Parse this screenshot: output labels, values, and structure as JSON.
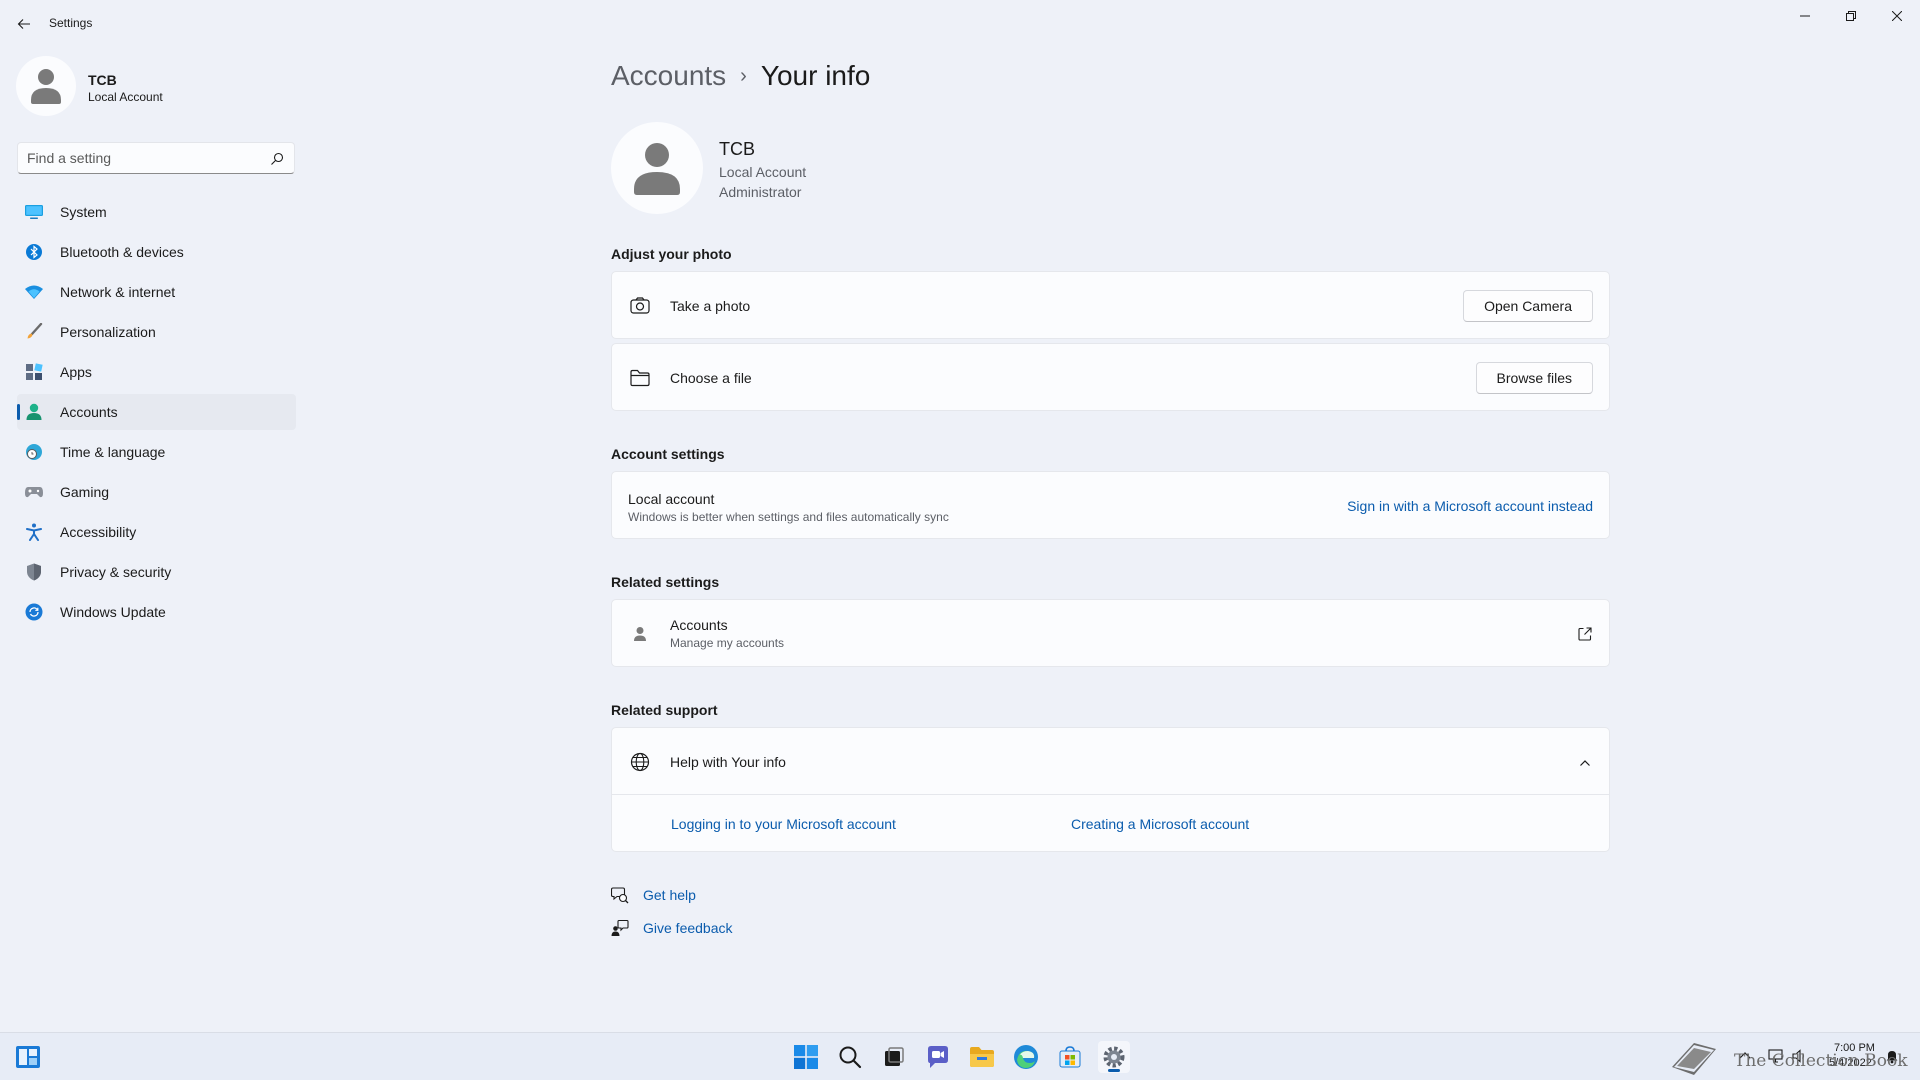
{
  "window": {
    "title": "Settings",
    "controls": [
      "minimize-icon",
      "restore-icon",
      "close-icon"
    ]
  },
  "profile": {
    "name": "TCB",
    "type": "Local Account"
  },
  "search": {
    "placeholder": "Find a setting"
  },
  "nav": {
    "items": [
      {
        "label": "System",
        "icon": "monitor-icon"
      },
      {
        "label": "Bluetooth & devices",
        "icon": "bluetooth-icon"
      },
      {
        "label": "Network & internet",
        "icon": "wifi-icon"
      },
      {
        "label": "Personalization",
        "icon": "brush-icon"
      },
      {
        "label": "Apps",
        "icon": "apps-icon"
      },
      {
        "label": "Accounts",
        "icon": "person-icon",
        "active": true
      },
      {
        "label": "Time & language",
        "icon": "globe-clock-icon"
      },
      {
        "label": "Gaming",
        "icon": "gamepad-icon"
      },
      {
        "label": "Accessibility",
        "icon": "accessibility-icon"
      },
      {
        "label": "Privacy & security",
        "icon": "shield-icon"
      },
      {
        "label": "Windows Update",
        "icon": "update-icon"
      }
    ]
  },
  "breadcrumb": {
    "parent": "Accounts",
    "separator": "›",
    "current": "Your info"
  },
  "user": {
    "name": "TCB",
    "account_type": "Local Account",
    "role": "Administrator"
  },
  "adjust_photo": {
    "title": "Adjust your photo",
    "take_photo": {
      "label": "Take a photo",
      "button": "Open Camera",
      "icon": "camera-icon"
    },
    "choose_file": {
      "label": "Choose a file",
      "button": "Browse files",
      "icon": "folder-icon"
    }
  },
  "account_settings": {
    "title": "Account settings",
    "local": {
      "label": "Local account",
      "description": "Windows is better when settings and files automatically sync",
      "link": "Sign in with a Microsoft account instead"
    }
  },
  "related_settings": {
    "title": "Related settings",
    "accounts": {
      "label": "Accounts",
      "description": "Manage my accounts",
      "icon": "person-icon",
      "action_icon": "external-link-icon"
    }
  },
  "related_support": {
    "title": "Related support",
    "help": {
      "label": "Help with Your info",
      "icon": "globe-icon",
      "expanded": true
    },
    "links": [
      "Logging in to your Microsoft account",
      "Creating a Microsoft account"
    ]
  },
  "footer": {
    "get_help": "Get help",
    "give_feedback": "Give feedback"
  },
  "taskbar": {
    "apps": [
      "widgets-icon",
      "start-icon",
      "search-icon",
      "task-view-icon",
      "chat-icon",
      "file-explorer-icon",
      "edge-icon",
      "store-icon",
      "settings-icon"
    ],
    "time": "7:00 PM",
    "date": "5/4/2022"
  },
  "watermark": {
    "text": "The Collection Book"
  },
  "colors": {
    "accent": "#0b5cad",
    "background": "#eef1f8",
    "card": "#fbfcfe"
  }
}
